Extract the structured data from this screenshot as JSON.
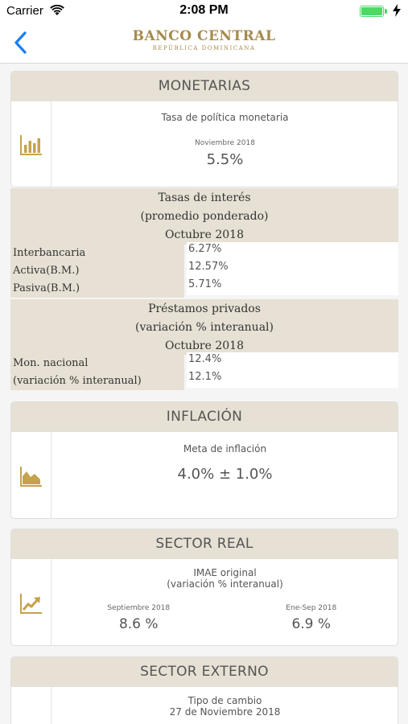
{
  "status_bar": {
    "carrier": "Carrier",
    "time": "2:08 PM"
  },
  "nav": {
    "logo_line1": "BANCO CENTRAL",
    "logo_line2": "REPÚBLICA DOMINICANA"
  },
  "monetarias": {
    "header": "MONETARIAS",
    "icon": "bar-chart-icon",
    "title": "Tasa de política monetaria",
    "date": "Noviembre 2018",
    "value": "5.5%"
  },
  "tasas_interes": {
    "header_lines": [
      "Tasas de interés",
      "(promedio ponderado)",
      "Octubre 2018"
    ],
    "rows": [
      {
        "label": "Interbancaria",
        "value": "6.27%"
      },
      {
        "label": "Activa(B.M.)",
        "value": "12.57%"
      },
      {
        "label": "Pasiva(B.M.)",
        "value": "5.71%"
      }
    ]
  },
  "prestamos": {
    "header_lines": [
      "Préstamos privados",
      "(variación % interanual)",
      "Octubre 2018"
    ],
    "rows": [
      {
        "label": "Mon. nacional",
        "value": "12.4%"
      },
      {
        "label": "(variación % interanual)",
        "value": "12.1%"
      }
    ]
  },
  "inflacion": {
    "header": "INFLACIÓN",
    "icon": "area-chart-icon",
    "title": "Meta de inflación",
    "value": "4.0% ± 1.0%"
  },
  "sector_real": {
    "header": "SECTOR REAL",
    "icon": "line-chart-icon",
    "title_line1": "IMAE original",
    "title_line2": "(variación % interanual)",
    "left_date": "Septiembre 2018",
    "left_value": "8.6 %",
    "right_date": "Ene-Sep 2018",
    "right_value": "6.9 %"
  },
  "sector_externo": {
    "header": "SECTOR EXTERNO",
    "icon": "pie-chart-icon",
    "title_line1": "Tipo de cambio",
    "title_line2": "27 de Noviembre 2018"
  },
  "colors": {
    "gold": "#a58b4c",
    "header_bg": "#e6e1d4",
    "ios_blue": "#1a7cf5",
    "battery_green": "#4cd964"
  }
}
